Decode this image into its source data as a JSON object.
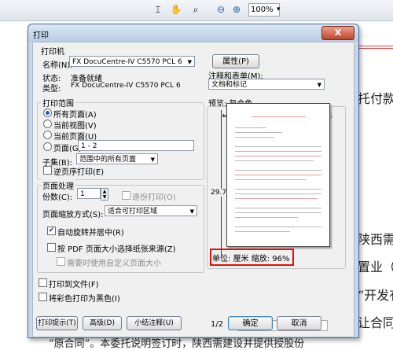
{
  "toolbar": {
    "zoom_value": "100%"
  },
  "background_doc": {
    "line1": "托付款",
    "line2": "陕西需",
    "line3": "置业（",
    "line4": "“开发有",
    "line5": "让合同",
    "line6": "“原合同”。本委托说明签订时，陕西需建设并提供授股份"
  },
  "dialog": {
    "title": "打印",
    "close_label": "X",
    "printer": {
      "group_label": "打印机",
      "name_label": "名称(N):",
      "name_value": "FX DocuCentre-IV C5570 PCL 6",
      "properties_button": "属性(P)",
      "status_label": "状态:",
      "status_value": "准备就绪",
      "type_label": "类型:",
      "type_value": "FX DocuCentre-IV C5570 PCL 6",
      "comments_label": "注释和表单(M):",
      "comments_value": "文档和标记"
    },
    "range": {
      "group_label": "打印范围",
      "all_pages": "所有页面(A)",
      "current_view": "当前视图(V)",
      "current_page": "当前页面(U)",
      "pages": "页面(G)",
      "pages_value": "1 - 2",
      "subset_label": "子集(B):",
      "subset_value": "范围中的所有页面",
      "reverse": "逆页序打印(E)"
    },
    "handling": {
      "group_label": "页面处理",
      "copies_label": "份数(C):",
      "copies_value": "1",
      "collate": "逐份打印(O)",
      "scaling_label": "页面缩放方式(S):",
      "scaling_value": "适合可打印区域",
      "auto_rotate": "自动旋转并居中(R)",
      "choose_paper": "按 PDF 页面大小选择纸张来源(Z)",
      "custom_paper": "需要时使用自定义页面大小"
    },
    "print_to_file": "打印到文件(F)",
    "print_grayscale": "将彩色打印为黑色(I)",
    "preview": {
      "label": "预览: 复合色",
      "width_value": "21",
      "height_value": "29.7",
      "units_zoom": "单位: 厘米 缩放: 96%",
      "page_counter": "1/2"
    },
    "buttons": {
      "tips": "打印提示(T)",
      "advanced": "高级(D)",
      "summarize": "小结注释(U)",
      "ok": "确定",
      "cancel": "取消"
    }
  }
}
